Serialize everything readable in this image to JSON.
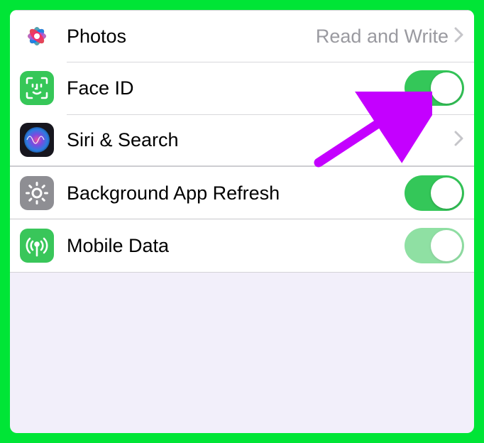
{
  "groups": [
    {
      "rows": [
        {
          "key": "photos",
          "label": "Photos",
          "value": "Read and Write",
          "hasChevron": true,
          "icon": "photos-icon"
        },
        {
          "key": "faceid",
          "label": "Face ID",
          "switch": "on",
          "icon": "faceid-icon"
        },
        {
          "key": "siri",
          "label": "Siri & Search",
          "hasChevron": true,
          "icon": "siri-icon"
        }
      ]
    },
    {
      "rows": [
        {
          "key": "bgrefresh",
          "label": "Background App Refresh",
          "switch": "on",
          "icon": "refresh-icon"
        },
        {
          "key": "mobiledata",
          "label": "Mobile Data",
          "switch": "on-dim",
          "icon": "mobile-icon"
        }
      ]
    }
  ],
  "colors": {
    "accent": "#34c759",
    "border": "#00e536",
    "annotation": "#c400ff"
  }
}
